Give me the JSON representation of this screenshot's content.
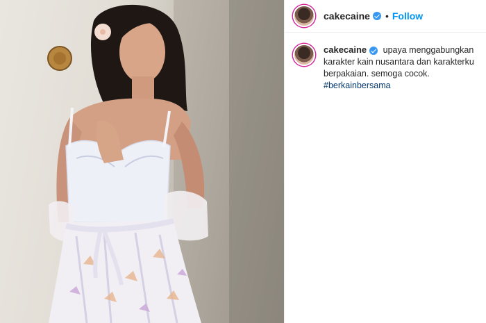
{
  "post": {
    "image_alt": "Woman in white lace camisole and floral sarong standing against a wall",
    "username": "cakecaine",
    "verified": true,
    "separator": "•",
    "follow_label": "Follow",
    "caption": {
      "username": "cakecaine",
      "text": "upaya menggabungkan karakter kain nusantara dan karakterku berpakaian. semoga cocok.",
      "hashtag": "#berkainbersama"
    }
  },
  "colors": {
    "accent": "#0095f6",
    "verified": "#3897f0",
    "hashtag": "#00376b",
    "text": "#262626",
    "border": "#efefef"
  }
}
